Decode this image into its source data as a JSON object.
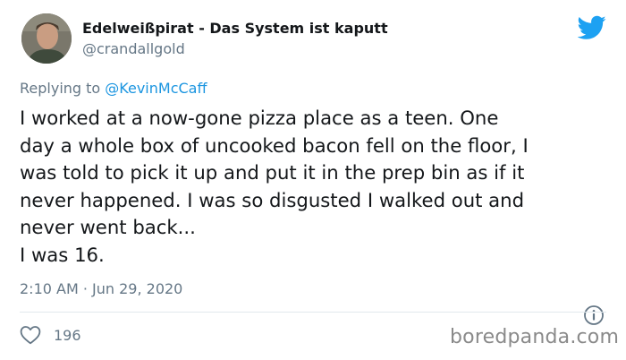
{
  "author": {
    "display_name": "Edelweißpirat - Das System ist kaputt",
    "handle": "@crandallgold"
  },
  "reply": {
    "prefix": "Replying to ",
    "mention": "@KevinMcCaff"
  },
  "tweet": {
    "lines": [
      "I worked at a now-gone pizza place as a teen. One",
      "day a whole box of uncooked bacon fell on the floor, I",
      "was told to pick it up and put it in the prep bin as if it",
      "never happened. I was so disgusted I walked out and",
      "never went back...",
      "I was 16."
    ],
    "timestamp": "2:10 AM · Jun 29, 2020"
  },
  "actions": {
    "like_count": "196"
  },
  "watermark": "boredpanda.com",
  "icons": {
    "brand": "twitter-bird-icon",
    "like": "heart-icon",
    "info": "info-icon"
  },
  "colors": {
    "brand_blue": "#1da1f2",
    "link_blue": "#1b95e0",
    "secondary_text": "#657786",
    "primary_text": "#14171a"
  }
}
